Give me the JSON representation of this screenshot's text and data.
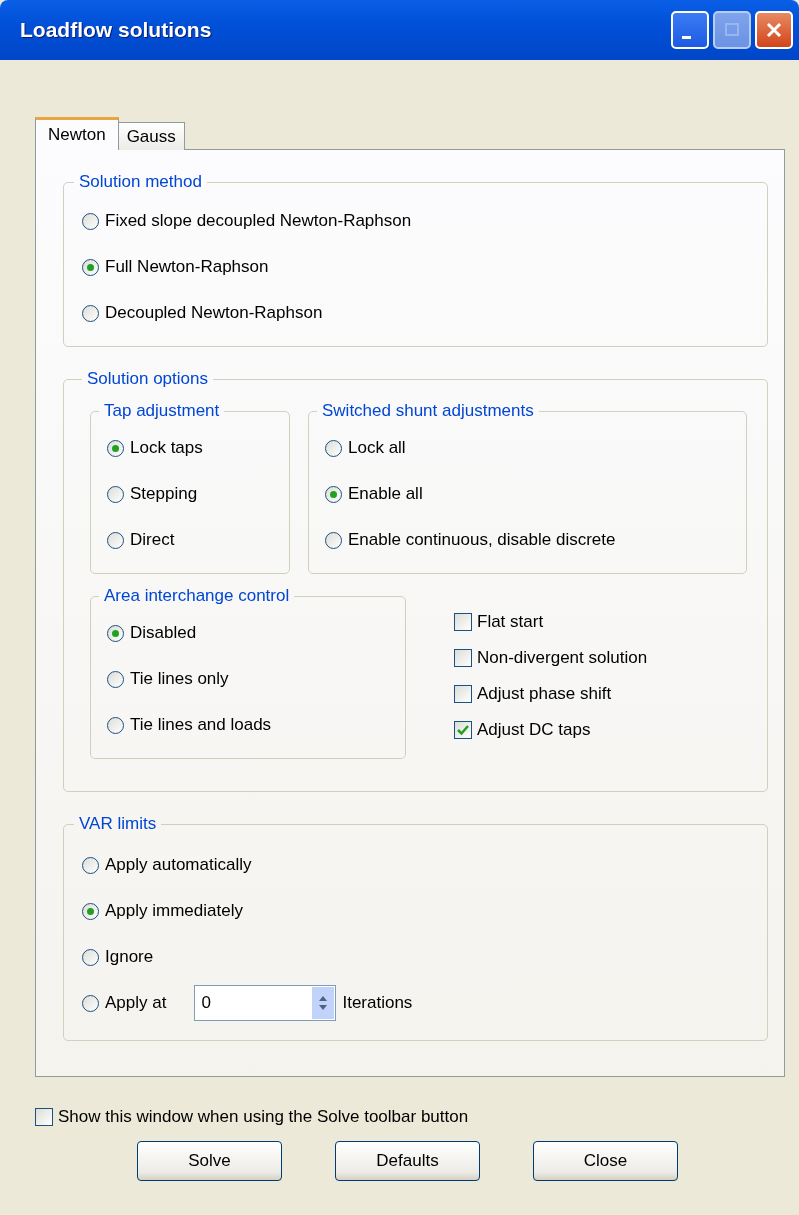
{
  "window": {
    "title": "Loadflow solutions"
  },
  "tabs": [
    {
      "label": "Newton",
      "selected": true
    },
    {
      "label": "Gauss",
      "selected": false
    }
  ],
  "solution_method": {
    "title": "Solution method",
    "options": [
      {
        "label": "Fixed slope decoupled Newton-Raphson",
        "selected": false
      },
      {
        "label": "Full Newton-Raphson",
        "selected": true
      },
      {
        "label": "Decoupled Newton-Raphson",
        "selected": false
      }
    ]
  },
  "solution_options": {
    "title": "Solution options",
    "tap_adjustment": {
      "title": "Tap adjustment",
      "options": [
        {
          "label": "Lock taps",
          "selected": true
        },
        {
          "label": "Stepping",
          "selected": false
        },
        {
          "label": "Direct",
          "selected": false
        }
      ]
    },
    "switched_shunt_adjustments": {
      "title": "Switched shunt adjustments",
      "options": [
        {
          "label": "Lock all",
          "selected": false
        },
        {
          "label": "Enable all",
          "selected": true
        },
        {
          "label": "Enable continuous, disable discrete",
          "selected": false
        }
      ]
    },
    "area_interchange_control": {
      "title": "Area interchange control",
      "options": [
        {
          "label": "Disabled",
          "selected": true
        },
        {
          "label": "Tie lines only",
          "selected": false
        },
        {
          "label": "Tie lines and loads",
          "selected": false
        }
      ]
    },
    "checkboxes": [
      {
        "label": "Flat start",
        "checked": false
      },
      {
        "label": "Non-divergent solution",
        "checked": false
      },
      {
        "label": "Adjust phase shift",
        "checked": false
      },
      {
        "label": "Adjust DC taps",
        "checked": true
      }
    ]
  },
  "var_limits": {
    "title": "VAR limits",
    "options": [
      {
        "kind": "plain",
        "label": "Apply automatically",
        "selected": false
      },
      {
        "kind": "plain",
        "label": "Apply immediately",
        "selected": true
      },
      {
        "kind": "plain",
        "label": "Ignore",
        "selected": false
      },
      {
        "kind": "spinner",
        "label": "Apply at",
        "selected": false,
        "value": "0",
        "unit": "Iterations"
      }
    ]
  },
  "show_window": {
    "label": "Show this window when using the Solve toolbar button",
    "checked": false
  },
  "buttons": [
    "Solve",
    "Defaults",
    "Close"
  ]
}
